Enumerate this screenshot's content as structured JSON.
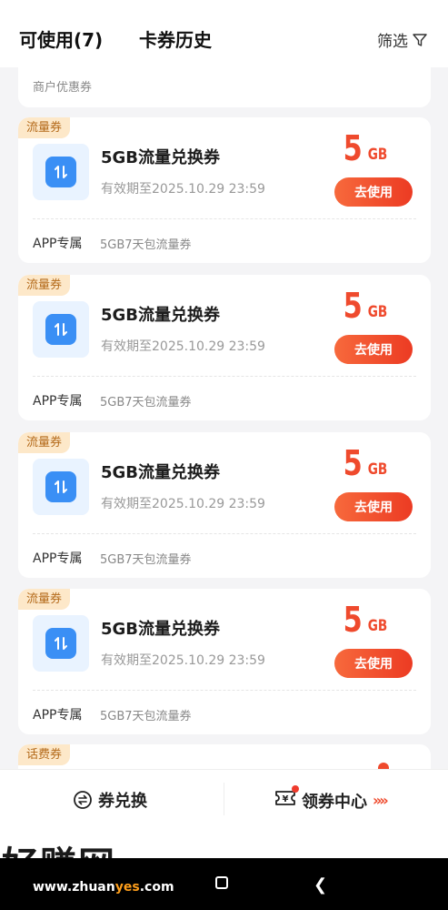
{
  "header": {
    "tab_available": "可使用(7)",
    "tab_history": "卡券历史",
    "filter_label": "筛选"
  },
  "merchant_section_label": "商户优惠券",
  "coupons": [
    {
      "tag": "流量券",
      "title": "5GB流量兑换券",
      "expiry": "有效期至2025.10.29 23:59",
      "amount": "5",
      "unit": "GB",
      "button": "去使用",
      "scope": "APP专属",
      "scope_desc": "5GB7天包流量券"
    },
    {
      "tag": "流量券",
      "title": "5GB流量兑换券",
      "expiry": "有效期至2025.10.29 23:59",
      "amount": "5",
      "unit": "GB",
      "button": "去使用",
      "scope": "APP专属",
      "scope_desc": "5GB7天包流量券"
    },
    {
      "tag": "流量券",
      "title": "5GB流量兑换券",
      "expiry": "有效期至2025.10.29 23:59",
      "amount": "5",
      "unit": "GB",
      "button": "去使用",
      "scope": "APP专属",
      "scope_desc": "5GB7天包流量券"
    },
    {
      "tag": "流量券",
      "title": "5GB流量兑换券",
      "expiry": "有效期至2025.10.29 23:59",
      "amount": "5",
      "unit": "GB",
      "button": "去使用",
      "scope": "APP专属",
      "scope_desc": "5GB7天包流量券"
    }
  ],
  "partial_card_tag": "话费券",
  "bottom": {
    "exchange_label": "券兑换",
    "center_label": "领券中心",
    "chevrons": "»»"
  },
  "watermark": {
    "brand": "好赚网",
    "url_prefix": "www.zhuan",
    "url_highlight": "yes",
    "url_suffix": ".com"
  },
  "colors": {
    "accent": "#ef4a2d",
    "icon_blue": "#3a8ff5",
    "tag_bg": "#fde8c9"
  }
}
